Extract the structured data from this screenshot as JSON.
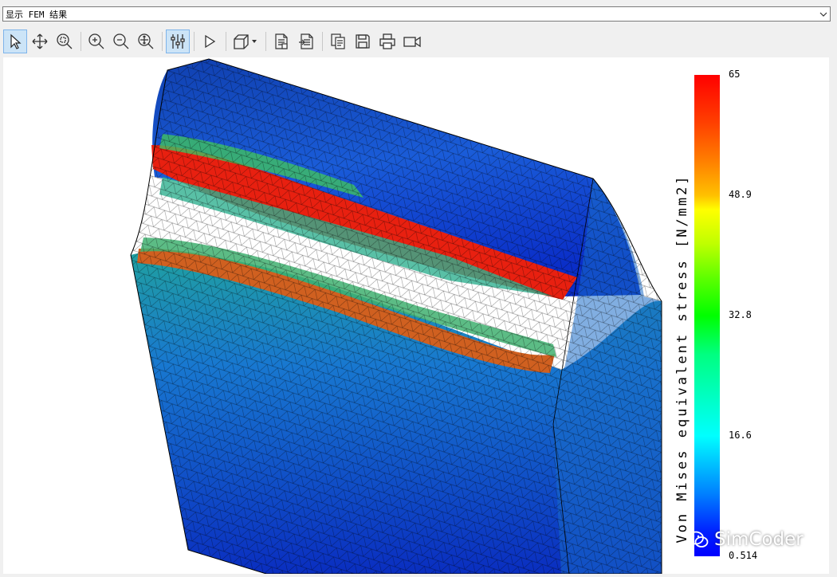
{
  "dropdown": {
    "value": "显示 FEM 结果"
  },
  "toolbar": {
    "buttons": [
      {
        "name": "select-arrow-icon",
        "active": true
      },
      {
        "name": "pan-move-icon",
        "active": false
      },
      {
        "name": "zoom-window-icon",
        "active": false
      },
      {
        "name": "zoom-in-icon",
        "active": false
      },
      {
        "name": "zoom-out-icon",
        "active": false
      },
      {
        "name": "zoom-fit-icon",
        "active": false
      },
      {
        "name": "settings-sliders-icon",
        "active": true
      },
      {
        "name": "play-icon",
        "active": false
      },
      {
        "name": "view-cube-icon",
        "active": false
      },
      {
        "name": "report-icon",
        "active": false
      },
      {
        "name": "export-report-icon",
        "active": false
      },
      {
        "name": "copy-icon",
        "active": false
      },
      {
        "name": "save-icon",
        "active": false
      },
      {
        "name": "print-icon",
        "active": false
      },
      {
        "name": "video-icon",
        "active": false
      }
    ]
  },
  "legend": {
    "title": "Von Mises equivalent stress [N/mm2]",
    "ticks": [
      "65",
      "48.9",
      "32.8",
      "16.6",
      "0.514"
    ],
    "max_color": "#ff0000",
    "min_color": "#0000ff"
  },
  "watermark": {
    "text": "SimCoder"
  }
}
